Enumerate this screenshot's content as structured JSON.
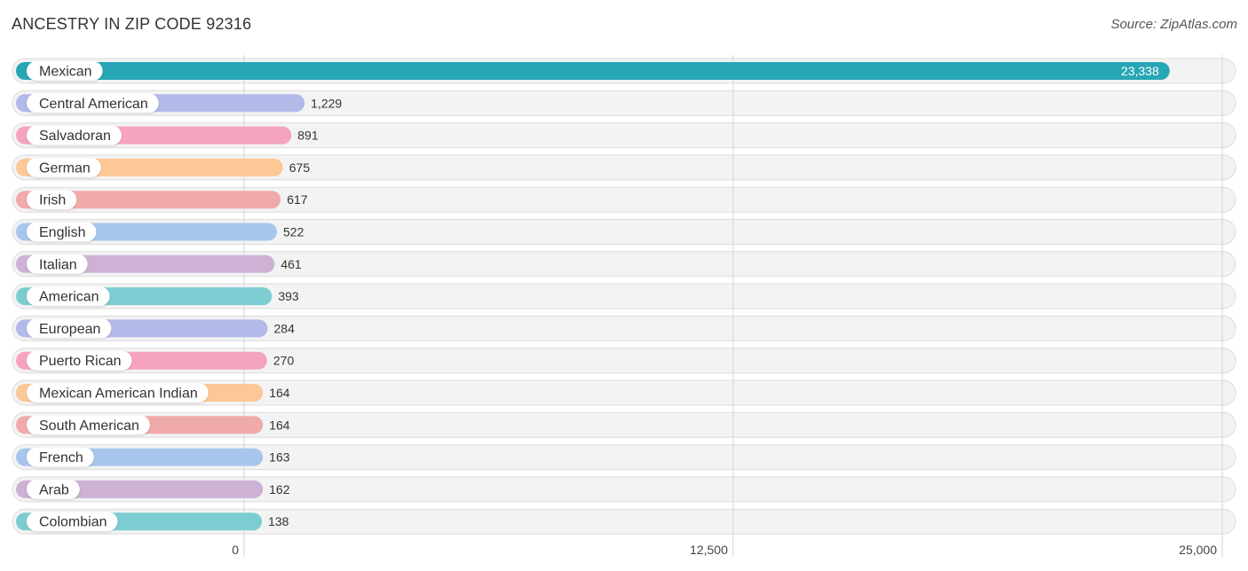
{
  "chart_data": {
    "type": "bar",
    "orientation": "horizontal",
    "title": "ANCESTRY IN ZIP CODE 92316",
    "source": "Source: ZipAtlas.com",
    "xlabel": "",
    "ylabel": "",
    "xlim": [
      0,
      25000
    ],
    "ticks": [
      {
        "value": 0,
        "label": "0"
      },
      {
        "value": 12500,
        "label": "12,500"
      },
      {
        "value": 25000,
        "label": "25,000"
      }
    ],
    "grid": true,
    "legend": "none",
    "categories": [
      "Mexican",
      "Central American",
      "Salvadoran",
      "German",
      "Irish",
      "English",
      "Italian",
      "American",
      "European",
      "Puerto Rican",
      "Mexican American Indian",
      "South American",
      "French",
      "Arab",
      "Colombian"
    ],
    "values": [
      23338,
      1229,
      891,
      675,
      617,
      522,
      461,
      393,
      284,
      270,
      164,
      164,
      163,
      162,
      138
    ],
    "value_labels": [
      "23,338",
      "1,229",
      "891",
      "675",
      "617",
      "522",
      "461",
      "393",
      "284",
      "270",
      "164",
      "164",
      "163",
      "162",
      "138"
    ],
    "colors": [
      "#27a6b5",
      "#b3b9e8",
      "#f5a3c0",
      "#fcc896",
      "#f0aaaa",
      "#a8c6ec",
      "#cdb2d6",
      "#7ccdd2",
      "#b3b9e8",
      "#f5a3c0",
      "#fcc896",
      "#f0aaaa",
      "#a8c6ec",
      "#cdb2d6",
      "#7ccdd2"
    ]
  }
}
